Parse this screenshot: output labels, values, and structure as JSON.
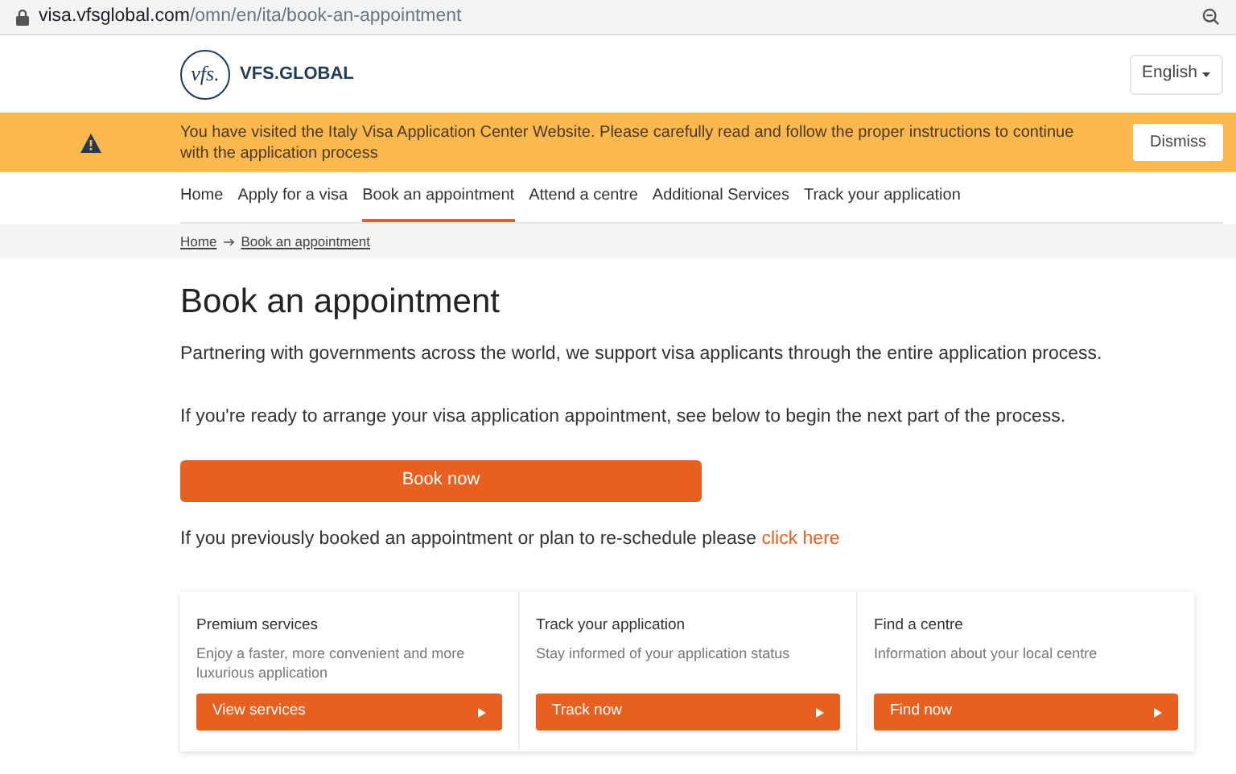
{
  "address_bar": {
    "host": "visa.vfsglobal.com",
    "path": "/omn/en/ita/book-an-appointment"
  },
  "header": {
    "logo_mark": "vfs.",
    "logo_text": "VFS.GLOBAL",
    "language": "English"
  },
  "banner": {
    "message": "You have visited the Italy Visa Application Center Website. Please carefully read and follow the proper instructions to continue with the application process",
    "button": "Dismiss"
  },
  "nav": [
    {
      "label": "Home",
      "selected": false
    },
    {
      "label": "Apply for a visa",
      "selected": false
    },
    {
      "label": "Book an appointment",
      "selected": true
    },
    {
      "label": "Attend a centre",
      "selected": false
    },
    {
      "label": "Additional Services",
      "selected": false
    },
    {
      "label": "Track your application",
      "selected": false
    }
  ],
  "breadcrumb": [
    "Home",
    "Book an appointment"
  ],
  "title": "Book an appointment",
  "intro": "Partnering with governments across the world, we support visa applicants through the entire application process.",
  "ready_text": "If you're ready to arrange your visa application appointment, see below to begin the next part of the process.",
  "book_button": "Book now",
  "reschedule": {
    "text": "If you previously booked an appointment or plan to re-schedule please",
    "link": "click here"
  },
  "cards": [
    {
      "title": "Premium services",
      "description": "Enjoy a faster, more convenient and more luxurious application",
      "button": "View services"
    },
    {
      "title": "Track your application",
      "description": "Stay informed of your application status",
      "button": "Track now"
    },
    {
      "title": "Find a centre",
      "description": "Information about your local centre",
      "button": "Find now"
    }
  ]
}
